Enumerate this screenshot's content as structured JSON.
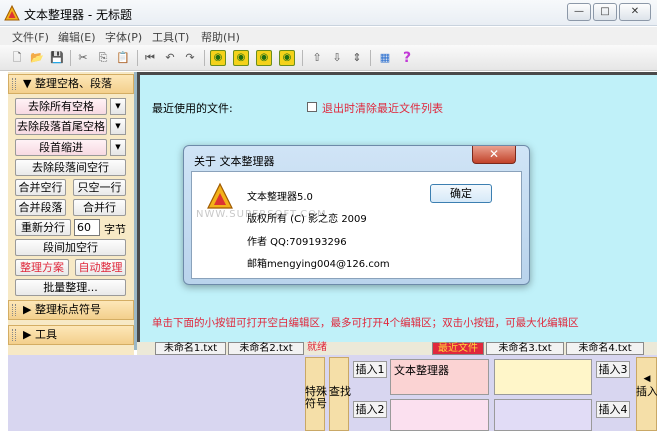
{
  "window": {
    "title": "文本整理器 - 无标题",
    "minimize": "—",
    "maximize": "□",
    "close": "✕"
  },
  "menu": [
    "文件(F)",
    "编辑(E)",
    "字体(P)",
    "工具(T)",
    "帮助(H)"
  ],
  "toolbar": {
    "new": "🗋",
    "open": "📂",
    "save": "💾",
    "cut": "✂",
    "copy": "⎘",
    "paste": "📋",
    "first": "⏮",
    "undo": "↶",
    "redo": "↷",
    "green1": "◉",
    "green2": "◉",
    "green3": "◉",
    "green4": "◉",
    "up": "⇧",
    "down": "⇩",
    "updown": "⇕",
    "palette": "▦",
    "help": "?"
  },
  "left": {
    "section1": "▼ 整理空格、段落",
    "remove_all_spaces": "去除所有空格",
    "remove_para_spaces": "去除段落首尾空格",
    "indent": "段首缩进",
    "remove_line_gaps": "去除段落间空行",
    "merge_empty_lines": "合并空行",
    "single_line": "只空一行",
    "merge_paragraphs": "合并段落",
    "merge_lines": "合并行",
    "rewrap": "重新分行",
    "rewrap_value": "60",
    "chars_unit": "字节",
    "add_blank_lines": "段间加空行",
    "scheme": "整理方案",
    "auto_tidy": "自动整理",
    "batch_tidy": "批量整理...",
    "section2": "▶ 整理标点符号",
    "section3": "▶ 工具",
    "dropdown_arrow": "▼"
  },
  "main": {
    "recent_label": "最近使用的文件:",
    "clear_recent_label": "退出时清除最近文件列表",
    "hint": "单击下面的小按钮可打开空白编辑区，最多可打开4个编辑区；双击小按钮，可最大化编辑区"
  },
  "tabs": [
    "未命名1.txt",
    "未命名2.txt",
    "就绪",
    "最近文件",
    "未命名3.txt",
    "未命名4.txt"
  ],
  "dialog": {
    "title": "关于 文本整理器",
    "close": "✕",
    "name": "文本整理器5.0",
    "copyright": "版权所有 (C) 影之恋 2009",
    "author": "作者 QQ:709193296",
    "email": "邮箱mengying004@126.com",
    "ok": "确定",
    "watermark": "NWW.SUPERSOFT.COM"
  },
  "bottom": {
    "special_symbols": "特殊符号",
    "find": "查找",
    "insert1": "插入1",
    "insert2": "插入2",
    "insert3": "插入3",
    "insert4": "插入4",
    "insert1_text": "文本整理器",
    "insert_side": "插入",
    "side_arrow": "◀"
  },
  "colors": {
    "main_bg": "#c0f1f9",
    "panel_bg": "#f7e9c6",
    "accent_red": "#e0283c"
  }
}
